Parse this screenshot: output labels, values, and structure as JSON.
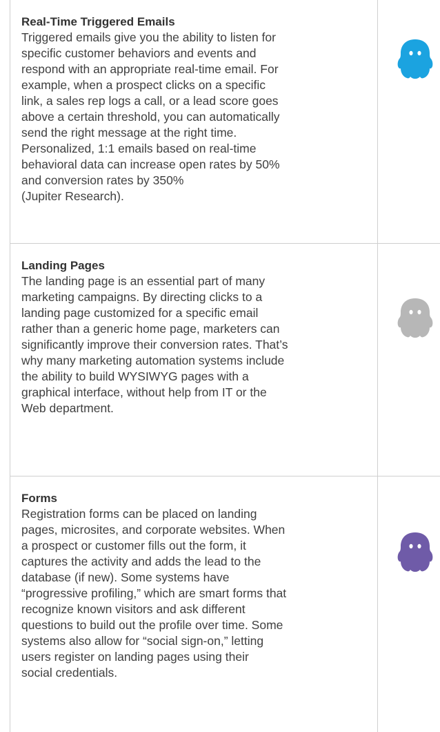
{
  "sections": [
    {
      "title": "Real-Time Triggered Emails",
      "lines": [
        "Triggered emails give you the ability to listen for",
        "specific customer behaviors and events and",
        "respond with an appropriate real-time email. For",
        "example, when a prospect clicks on a specific",
        "link, a sales rep logs a call, or a lead score goes",
        "above a certain threshold, you can automatically",
        "send the right message at the right time.",
        "Personalized, 1:1 emails based on real-time",
        "behavioral data can increase open rates by 50%",
        "and conversion rates by 350%",
        "(Jupiter Research)."
      ],
      "icon": "blue-mascot-icon",
      "icon_color": "#1ba3e0"
    },
    {
      "title": "Landing Pages",
      "lines": [
        "The landing page is an essential part of many",
        "marketing campaigns. By directing clicks to a",
        "landing page customized for a specific email",
        "rather than a generic home page, marketers can",
        "significantly improve their conversion rates. That’s",
        "why many marketing automation systems include",
        "the ability to build WYSIWYG pages with a",
        "graphical interface, without help from IT or the",
        "Web department."
      ],
      "icon": "gray-mascot-icon",
      "icon_color": "#b7b7b7"
    },
    {
      "title": "Forms",
      "lines": [
        "Registration forms can be placed on landing",
        "pages, microsites, and corporate websites. When",
        "a prospect or customer fills out the form, it",
        "captures the activity and adds the lead to the",
        "database (if new). Some systems have",
        "“progressive profiling,” which are smart forms that",
        "recognize known visitors and ask different",
        "questions to build out the profile over time. Some",
        "systems also allow for “social sign-on,” letting",
        "users register on landing pages using their",
        "social credentials."
      ],
      "icon": "purple-mascot-icon",
      "icon_color": "#6f5ba8"
    }
  ]
}
